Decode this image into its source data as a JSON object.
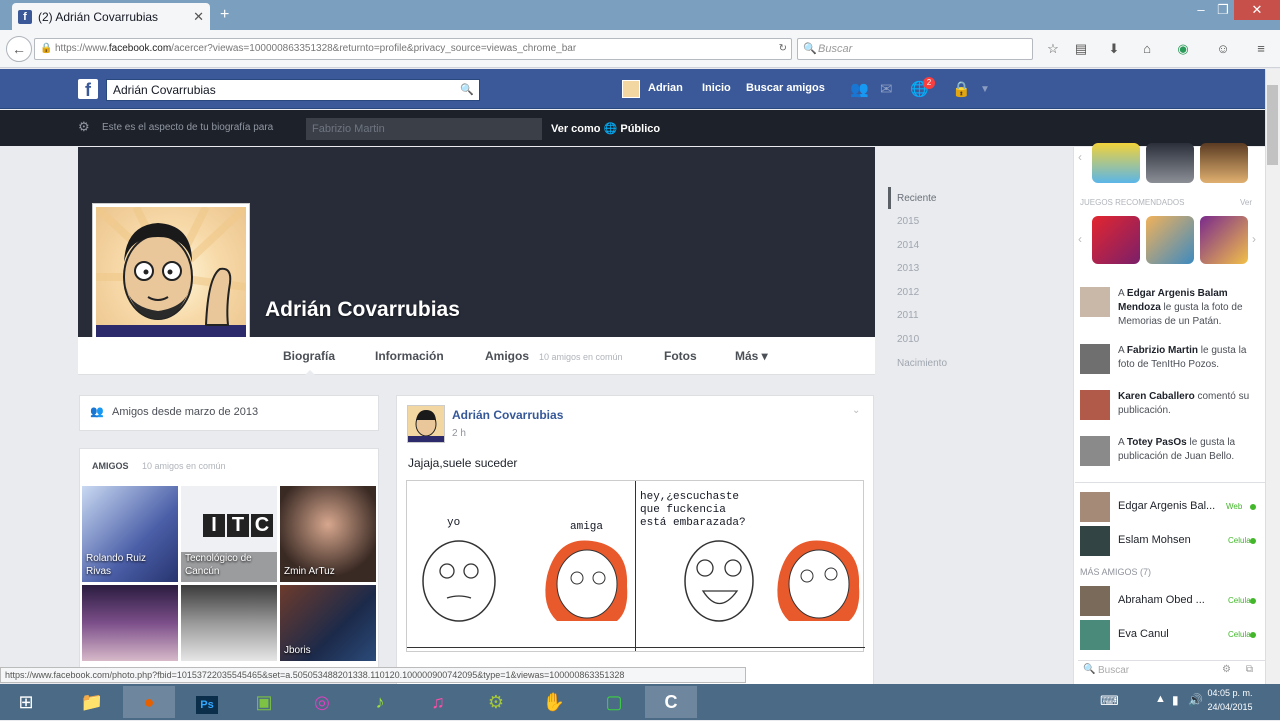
{
  "browser": {
    "tab_title": "(2) Adrián Covarrubias",
    "url_prefix": "https://www.",
    "url_domain": "facebook.com",
    "url_rest": "/acercer?viewas=100000863351328&returnto=profile&privacy_source=viewas_chrome_bar",
    "search_placeholder": "Buscar"
  },
  "fb_header": {
    "search_value": "Adrián Covarrubias",
    "user_link": "Adrian",
    "home_link": "Inicio",
    "find_friends": "Buscar amigos",
    "notif_count": "2"
  },
  "viewas_bar": {
    "prefix": "Este es el aspecto de tu biografía para",
    "input_placeholder": "Fabrizio Martin",
    "label": "Ver como",
    "audience": "Público"
  },
  "profile": {
    "name": "Adrián Covarrubias",
    "tabs": [
      {
        "label": "Biografía"
      },
      {
        "label": "Información"
      },
      {
        "label": "Amigos",
        "extra": "10 amigos en común"
      },
      {
        "label": "Fotos"
      },
      {
        "label": "Más ▾"
      }
    ]
  },
  "timeline_years": [
    "Reciente",
    "2015",
    "2014",
    "2013",
    "2012",
    "2011",
    "2010",
    "Nacimiento"
  ],
  "left": {
    "friends_since": "Amigos desde marzo de 2013",
    "friends_title": "AMIGOS",
    "friends_count": "10 amigos en común",
    "friend_tiles": [
      {
        "caption": "Rolando Ruiz\nRivas"
      },
      {
        "caption": "Tecnológico de\nCancún"
      },
      {
        "caption": "Zmin ArTuz"
      },
      {
        "caption": ""
      },
      {
        "caption": ""
      },
      {
        "caption": "Jboris"
      }
    ],
    "itc_logo": "ITC"
  },
  "post": {
    "author": "Adrián Covarrubias",
    "time": "2 h",
    "text": "Jajaja,suele suceder",
    "comic": {
      "panel1_yo": "yo",
      "panel1_amiga": "amiga",
      "panel2_text": "hey,¿escuchaste\nque fuckencia\nestá embarazada?"
    }
  },
  "right": {
    "games_label": "JUEGOS RECOMENDADOS",
    "games_more": "Ver",
    "tickers": [
      {
        "text_pre": "A ",
        "bold": "Edgar Argenis Balam Mendoza",
        "text_post": " le gusta la foto de Memorias de un Patán."
      },
      {
        "text_pre": "A ",
        "bold": "Fabrizio Martin",
        "text_post": " le gusta la foto de TenItHo Pozos."
      },
      {
        "text_pre": "",
        "bold": "Karen Caballero",
        "text_post": " comentó su publicación."
      },
      {
        "text_pre": "A ",
        "bold": "Totey PasOs",
        "text_post": " le gusta la publicación de Juan Bello."
      }
    ],
    "chat": [
      {
        "name": "Edgar Argenis Bal...",
        "status": "Web"
      },
      {
        "name": "Eslam Mohsen",
        "status": "Celular"
      }
    ],
    "more_friends": "MÁS AMIGOS (7)",
    "chat_more": [
      {
        "name": "Abraham Obed ...",
        "status": "Celular"
      },
      {
        "name": "Eva Canul",
        "status": "Celular"
      }
    ],
    "chat_search": "Buscar"
  },
  "status_url": "https://www.facebook.com/photo.php?fbid=10153722035545465&set=a.505053488201338.110120.100000900742095&type=1&viewas=100000863351328",
  "taskbar": {
    "time": "04:05 p. m.",
    "date": "24/04/2015"
  }
}
